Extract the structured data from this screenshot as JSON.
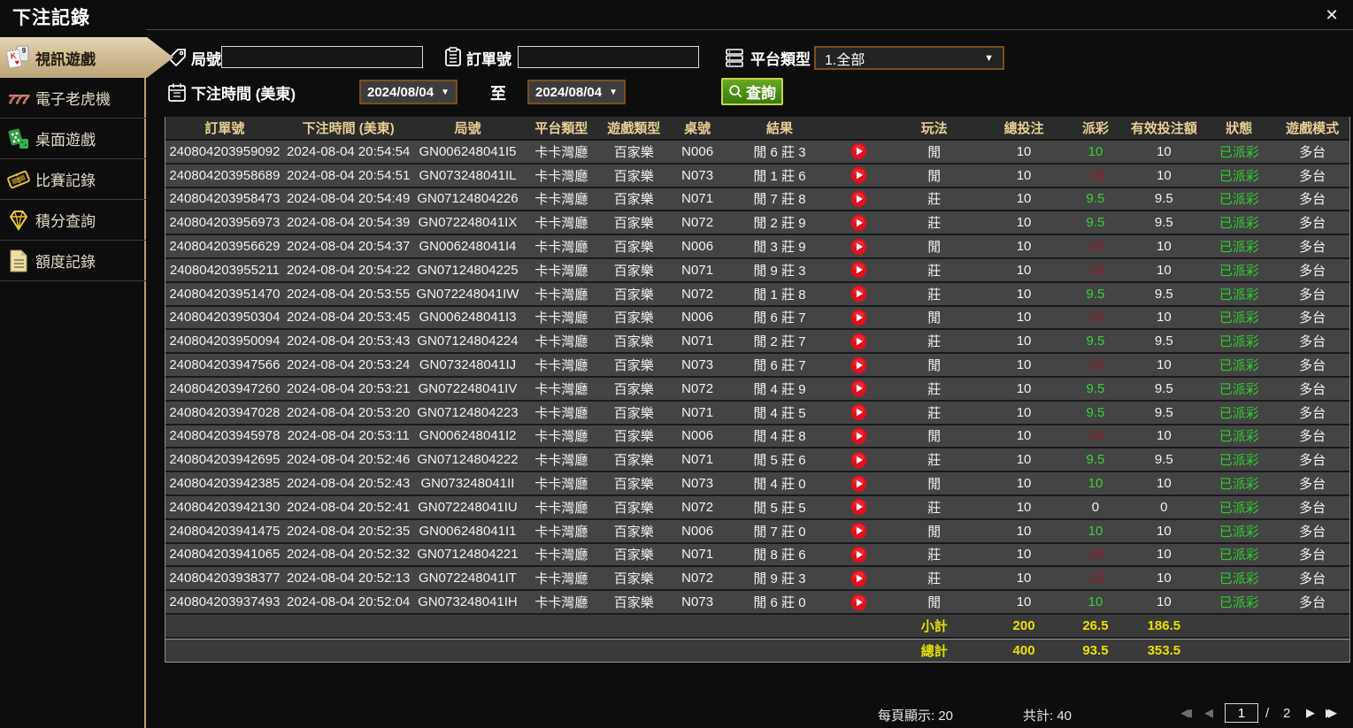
{
  "window": {
    "title": "下注記錄",
    "close_icon": "✕"
  },
  "sidebar": {
    "items": [
      {
        "label": "視訊遊戲",
        "icon": "cards-icon",
        "active": true
      },
      {
        "label": "電子老虎機",
        "icon": "slot-777-icon",
        "active": false
      },
      {
        "label": "桌面遊戲",
        "icon": "dice-icon",
        "active": false
      },
      {
        "label": "比賽記錄",
        "icon": "ticket-icon",
        "active": false
      },
      {
        "label": "積分查詢",
        "icon": "diamond-icon",
        "active": false
      },
      {
        "label": "額度記錄",
        "icon": "document-icon",
        "active": false
      }
    ]
  },
  "filters": {
    "round_label": "局號",
    "order_label": "訂單號",
    "platform_label": "平台類型",
    "platform_value": "1.全部",
    "platform_arrow": "▼",
    "time_label": "下注時間 (美東)",
    "date_from": "2024/08/04",
    "date_to": "2024/08/04",
    "date_arrow": "▼",
    "to_label": "至",
    "search_label": "查詢"
  },
  "table": {
    "columns": [
      "訂單號",
      "下注時間 (美東)",
      "局號",
      "平台類型",
      "遊戲類型",
      "桌號",
      "結果",
      "",
      "玩法",
      "總投注",
      "派彩",
      "有效投注額",
      "狀態",
      "遊戲模式"
    ],
    "rows": [
      {
        "order": "240804203959092",
        "time": "2024-08-04 20:54:54",
        "round": "GN006248041I5",
        "platform": "卡卡灣廳",
        "game": "百家樂",
        "table": "N006",
        "result": "閒 6 莊 3",
        "method": "閒",
        "total": "10",
        "payout": "10",
        "payout_color": "pos",
        "valid": "10",
        "status": "已派彩",
        "mode": "多台"
      },
      {
        "order": "240804203958689",
        "time": "2024-08-04 20:54:51",
        "round": "GN073248041IL",
        "platform": "卡卡灣廳",
        "game": "百家樂",
        "table": "N073",
        "result": "閒 1 莊 6",
        "method": "閒",
        "total": "10",
        "payout": "-10",
        "payout_color": "neg",
        "valid": "10",
        "status": "已派彩",
        "mode": "多台"
      },
      {
        "order": "240804203958473",
        "time": "2024-08-04 20:54:49",
        "round": "GN07124804226",
        "platform": "卡卡灣廳",
        "game": "百家樂",
        "table": "N071",
        "result": "閒 7 莊 8",
        "method": "莊",
        "total": "10",
        "payout": "9.5",
        "payout_color": "pos",
        "valid": "9.5",
        "status": "已派彩",
        "mode": "多台"
      },
      {
        "order": "240804203956973",
        "time": "2024-08-04 20:54:39",
        "round": "GN072248041IX",
        "platform": "卡卡灣廳",
        "game": "百家樂",
        "table": "N072",
        "result": "閒 2 莊 9",
        "method": "莊",
        "total": "10",
        "payout": "9.5",
        "payout_color": "pos",
        "valid": "9.5",
        "status": "已派彩",
        "mode": "多台"
      },
      {
        "order": "240804203956629",
        "time": "2024-08-04 20:54:37",
        "round": "GN006248041I4",
        "platform": "卡卡灣廳",
        "game": "百家樂",
        "table": "N006",
        "result": "閒 3 莊 9",
        "method": "閒",
        "total": "10",
        "payout": "-10",
        "payout_color": "neg",
        "valid": "10",
        "status": "已派彩",
        "mode": "多台"
      },
      {
        "order": "240804203955211",
        "time": "2024-08-04 20:54:22",
        "round": "GN07124804225",
        "platform": "卡卡灣廳",
        "game": "百家樂",
        "table": "N071",
        "result": "閒 9 莊 3",
        "method": "莊",
        "total": "10",
        "payout": "-10",
        "payout_color": "neg",
        "valid": "10",
        "status": "已派彩",
        "mode": "多台"
      },
      {
        "order": "240804203951470",
        "time": "2024-08-04 20:53:55",
        "round": "GN072248041IW",
        "platform": "卡卡灣廳",
        "game": "百家樂",
        "table": "N072",
        "result": "閒 1 莊 8",
        "method": "莊",
        "total": "10",
        "payout": "9.5",
        "payout_color": "pos",
        "valid": "9.5",
        "status": "已派彩",
        "mode": "多台"
      },
      {
        "order": "240804203950304",
        "time": "2024-08-04 20:53:45",
        "round": "GN006248041I3",
        "platform": "卡卡灣廳",
        "game": "百家樂",
        "table": "N006",
        "result": "閒 6 莊 7",
        "method": "閒",
        "total": "10",
        "payout": "-10",
        "payout_color": "neg",
        "valid": "10",
        "status": "已派彩",
        "mode": "多台"
      },
      {
        "order": "240804203950094",
        "time": "2024-08-04 20:53:43",
        "round": "GN07124804224",
        "platform": "卡卡灣廳",
        "game": "百家樂",
        "table": "N071",
        "result": "閒 2 莊 7",
        "method": "莊",
        "total": "10",
        "payout": "9.5",
        "payout_color": "pos",
        "valid": "9.5",
        "status": "已派彩",
        "mode": "多台"
      },
      {
        "order": "240804203947566",
        "time": "2024-08-04 20:53:24",
        "round": "GN073248041IJ",
        "platform": "卡卡灣廳",
        "game": "百家樂",
        "table": "N073",
        "result": "閒 6 莊 7",
        "method": "閒",
        "total": "10",
        "payout": "-10",
        "payout_color": "neg",
        "valid": "10",
        "status": "已派彩",
        "mode": "多台"
      },
      {
        "order": "240804203947260",
        "time": "2024-08-04 20:53:21",
        "round": "GN072248041IV",
        "platform": "卡卡灣廳",
        "game": "百家樂",
        "table": "N072",
        "result": "閒 4 莊 9",
        "method": "莊",
        "total": "10",
        "payout": "9.5",
        "payout_color": "pos",
        "valid": "9.5",
        "status": "已派彩",
        "mode": "多台"
      },
      {
        "order": "240804203947028",
        "time": "2024-08-04 20:53:20",
        "round": "GN07124804223",
        "platform": "卡卡灣廳",
        "game": "百家樂",
        "table": "N071",
        "result": "閒 4 莊 5",
        "method": "莊",
        "total": "10",
        "payout": "9.5",
        "payout_color": "pos",
        "valid": "9.5",
        "status": "已派彩",
        "mode": "多台"
      },
      {
        "order": "240804203945978",
        "time": "2024-08-04 20:53:11",
        "round": "GN006248041I2",
        "platform": "卡卡灣廳",
        "game": "百家樂",
        "table": "N006",
        "result": "閒 4 莊 8",
        "method": "閒",
        "total": "10",
        "payout": "-10",
        "payout_color": "neg",
        "valid": "10",
        "status": "已派彩",
        "mode": "多台"
      },
      {
        "order": "240804203942695",
        "time": "2024-08-04 20:52:46",
        "round": "GN07124804222",
        "platform": "卡卡灣廳",
        "game": "百家樂",
        "table": "N071",
        "result": "閒 5 莊 6",
        "method": "莊",
        "total": "10",
        "payout": "9.5",
        "payout_color": "pos",
        "valid": "9.5",
        "status": "已派彩",
        "mode": "多台"
      },
      {
        "order": "240804203942385",
        "time": "2024-08-04 20:52:43",
        "round": "GN073248041II",
        "platform": "卡卡灣廳",
        "game": "百家樂",
        "table": "N073",
        "result": "閒 4 莊 0",
        "method": "閒",
        "total": "10",
        "payout": "10",
        "payout_color": "pos",
        "valid": "10",
        "status": "已派彩",
        "mode": "多台"
      },
      {
        "order": "240804203942130",
        "time": "2024-08-04 20:52:41",
        "round": "GN072248041IU",
        "platform": "卡卡灣廳",
        "game": "百家樂",
        "table": "N072",
        "result": "閒 5 莊 5",
        "method": "莊",
        "total": "10",
        "payout": "0",
        "payout_color": "zero",
        "valid": "0",
        "status": "已派彩",
        "mode": "多台"
      },
      {
        "order": "240804203941475",
        "time": "2024-08-04 20:52:35",
        "round": "GN006248041I1",
        "platform": "卡卡灣廳",
        "game": "百家樂",
        "table": "N006",
        "result": "閒 7 莊 0",
        "method": "閒",
        "total": "10",
        "payout": "10",
        "payout_color": "pos",
        "valid": "10",
        "status": "已派彩",
        "mode": "多台"
      },
      {
        "order": "240804203941065",
        "time": "2024-08-04 20:52:32",
        "round": "GN07124804221",
        "platform": "卡卡灣廳",
        "game": "百家樂",
        "table": "N071",
        "result": "閒 8 莊 6",
        "method": "莊",
        "total": "10",
        "payout": "-10",
        "payout_color": "neg",
        "valid": "10",
        "status": "已派彩",
        "mode": "多台"
      },
      {
        "order": "240804203938377",
        "time": "2024-08-04 20:52:13",
        "round": "GN072248041IT",
        "platform": "卡卡灣廳",
        "game": "百家樂",
        "table": "N072",
        "result": "閒 9 莊 3",
        "method": "莊",
        "total": "10",
        "payout": "-10",
        "payout_color": "neg",
        "valid": "10",
        "status": "已派彩",
        "mode": "多台"
      },
      {
        "order": "240804203937493",
        "time": "2024-08-04 20:52:04",
        "round": "GN073248041IH",
        "platform": "卡卡灣廳",
        "game": "百家樂",
        "table": "N073",
        "result": "閒 6 莊 0",
        "method": "閒",
        "total": "10",
        "payout": "10",
        "payout_color": "pos",
        "valid": "10",
        "status": "已派彩",
        "mode": "多台"
      }
    ],
    "subtotal": {
      "label": "小計",
      "total": "200",
      "payout": "26.5",
      "valid": "186.5"
    },
    "grand_total": {
      "label": "總計",
      "total": "400",
      "payout": "93.5",
      "valid": "353.5"
    }
  },
  "pagination": {
    "per_page_label": "每頁顯示: 20",
    "total_label": "共計: 40",
    "current_page": "1",
    "separator": "/",
    "total_pages": "2"
  },
  "colors": {
    "accent_tan": "#cdb88f",
    "header_text": "#e7cf96",
    "positive_green": "#35d435",
    "negative_red": "#a81225",
    "status_green": "#2ecc2e",
    "summary_yellow": "#e9e000",
    "button_green": "#4b8d13",
    "border_brown": "#7b4e1b",
    "play_red": "#e1101e"
  }
}
